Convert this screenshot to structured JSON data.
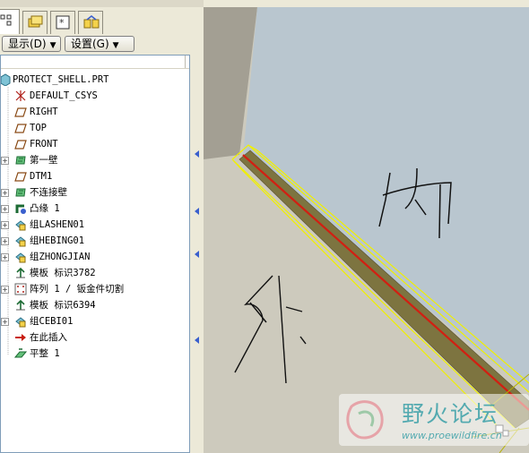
{
  "toolbar": {
    "display_menu": "显示(D)",
    "settings_menu": "设置(G)"
  },
  "tree": {
    "root": "PROTECT_SHELL.PRT",
    "items": [
      {
        "label": "DEFAULT_CSYS",
        "icon": "csys-icon",
        "expandable": false
      },
      {
        "label": "RIGHT",
        "icon": "datum-plane-icon",
        "expandable": false
      },
      {
        "label": "TOP",
        "icon": "datum-plane-icon",
        "expandable": false
      },
      {
        "label": "FRONT",
        "icon": "datum-plane-icon",
        "expandable": false
      },
      {
        "label": "第一壁",
        "icon": "sheetmetal-wall-icon",
        "expandable": true
      },
      {
        "label": "DTM1",
        "icon": "datum-plane-icon",
        "expandable": false
      },
      {
        "label": "不连接壁",
        "icon": "sheetmetal-wall-icon",
        "expandable": true
      },
      {
        "label": "凸缘 1",
        "icon": "flange-icon",
        "expandable": true
      },
      {
        "label": "组LASHEN01",
        "icon": "group-icon",
        "expandable": true
      },
      {
        "label": "组HEBING01",
        "icon": "group-icon",
        "expandable": true
      },
      {
        "label": "组ZHONGJIAN",
        "icon": "group-icon",
        "expandable": true
      },
      {
        "label": "模板 标识3782",
        "icon": "template-icon",
        "expandable": false
      },
      {
        "label": "阵列 1 / 钣金件切割",
        "icon": "pattern-icon",
        "expandable": true
      },
      {
        "label": "模板 标识6394",
        "icon": "template-icon",
        "expandable": false
      },
      {
        "label": "组CEBI01",
        "icon": "group-icon",
        "expandable": true
      },
      {
        "label": "在此插入",
        "icon": "insert-arrow-icon",
        "expandable": false
      },
      {
        "label": "平整 1",
        "icon": "flatten-icon",
        "expandable": false
      }
    ]
  },
  "viewport": {
    "annotation_inside": "内",
    "annotation_outside": "外"
  },
  "watermark": {
    "title": "野火论坛",
    "url": "www.proewildfire.cn"
  },
  "colors": {
    "face_blue": "#b9c6cf",
    "face_beige": "#cdcabd",
    "edge_red": "#d21f12",
    "highlight_yellow": "#f0f000",
    "wall_olive": "#7d7440"
  }
}
